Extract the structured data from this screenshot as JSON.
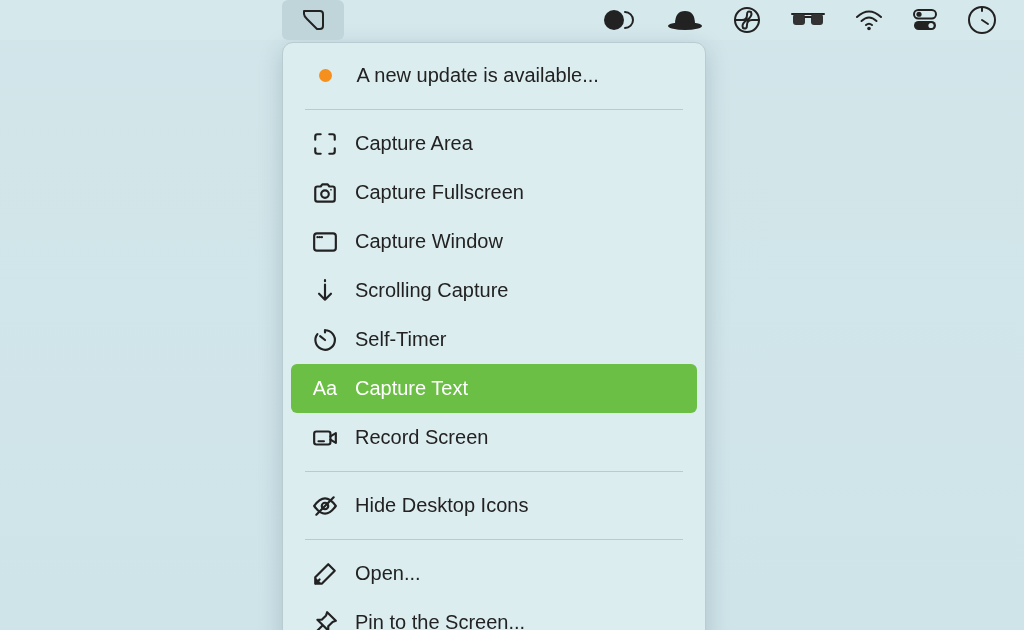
{
  "menu_bar": {
    "app_icon_active": true
  },
  "menu": {
    "items": [
      {
        "kind": "notice",
        "label": "A new update is available...",
        "color": "#f5901e"
      },
      {
        "kind": "separator"
      },
      {
        "kind": "action",
        "label": "Capture Area",
        "selected": false
      },
      {
        "kind": "action",
        "label": "Capture Fullscreen",
        "selected": false
      },
      {
        "kind": "action",
        "label": "Capture Window",
        "selected": false
      },
      {
        "kind": "action",
        "label": "Scrolling Capture",
        "selected": false
      },
      {
        "kind": "action",
        "label": "Self-Timer",
        "selected": false
      },
      {
        "kind": "action",
        "label": "Capture Text",
        "glyph": "Aa",
        "selected": true
      },
      {
        "kind": "action",
        "label": "Record Screen",
        "selected": false
      },
      {
        "kind": "separator"
      },
      {
        "kind": "action",
        "label": "Hide Desktop Icons",
        "selected": false
      },
      {
        "kind": "separator"
      },
      {
        "kind": "action",
        "label": "Open...",
        "selected": false
      },
      {
        "kind": "action",
        "label": "Pin to the Screen...",
        "selected": false
      }
    ]
  }
}
